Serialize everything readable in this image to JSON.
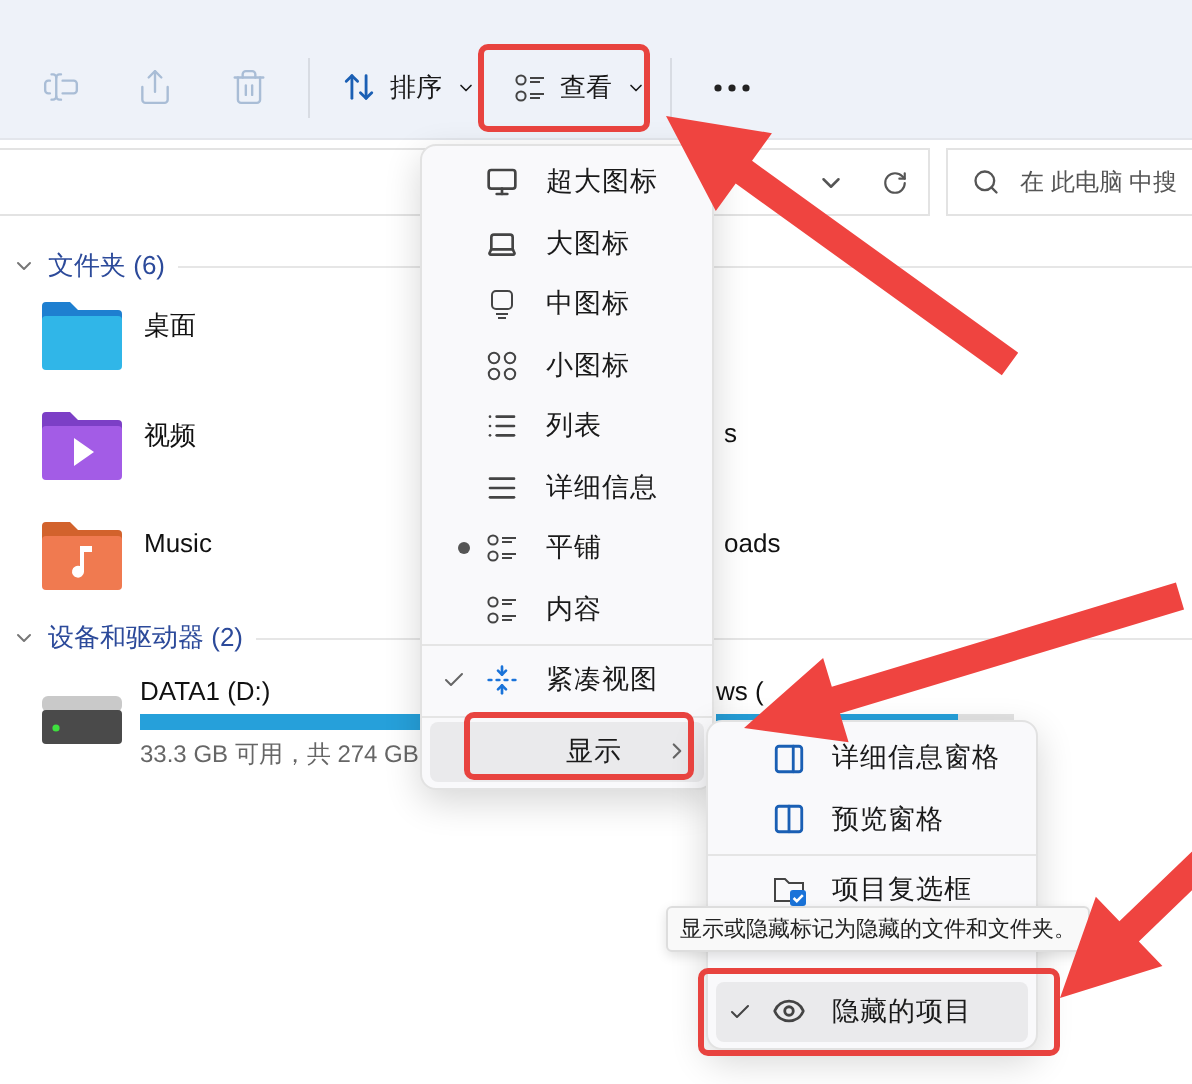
{
  "toolbar": {
    "icon_buttons": [
      {
        "kind": "rename",
        "disabled": true
      },
      {
        "kind": "share",
        "disabled": true
      },
      {
        "kind": "delete",
        "disabled": true
      }
    ],
    "sort_button": {
      "label": "排序"
    },
    "view_button": {
      "label": "查看"
    }
  },
  "search": {
    "placeholder": "在 此电脑 中搜"
  },
  "folders_section": {
    "title": "文件夹 (6)",
    "expanded": true
  },
  "folders": [
    {
      "name": "桌面",
      "kind": "desktop"
    },
    {
      "name": "视频",
      "kind": "videos",
      "right": "s"
    },
    {
      "name": "Music",
      "kind": "music",
      "right": "oads"
    }
  ],
  "drives_section": {
    "title": "设备和驱动器 (2)",
    "expanded": true
  },
  "drives": [
    {
      "name": "DATA1 (D:)",
      "level": 0.95,
      "free": "33.3 GB 可用，共 274 GB"
    },
    {
      "name": "ws (",
      "level": 0.81
    }
  ],
  "view_menu": {
    "items": [
      {
        "label": "超大图标",
        "selected": false
      },
      {
        "label": "大图标",
        "selected": false
      },
      {
        "label": "中图标",
        "selected": false
      },
      {
        "label": "小图标",
        "selected": false
      },
      {
        "label": "列表",
        "selected": false
      },
      {
        "label": "详细信息",
        "selected": false
      },
      {
        "label": "平铺",
        "selected": true
      },
      {
        "label": "内容",
        "selected": false
      }
    ],
    "compact": {
      "label": "紧凑视图",
      "checked": true
    },
    "show": {
      "label": "显示",
      "highlighted": true
    }
  },
  "show_submenu": {
    "items": [
      {
        "label": "详细信息窗格",
        "checked": false,
        "highlighted": false
      },
      {
        "label": "预览窗格",
        "checked": false,
        "highlighted": false
      },
      {
        "label": "项目复选框",
        "checked": false,
        "highlighted": false
      },
      {
        "label": "隐藏的项目",
        "checked": true,
        "highlighted": true
      }
    ]
  },
  "tooltip": {
    "text": "显示或隐藏标记为隐藏的文件和文件夹。"
  }
}
